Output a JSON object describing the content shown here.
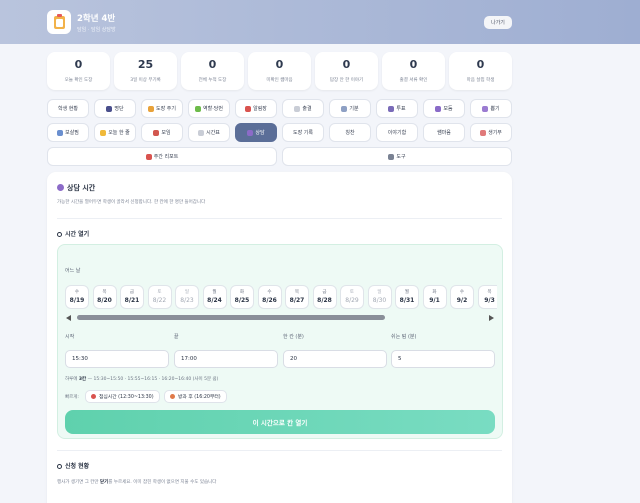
{
  "header": {
    "title": "2학년 4반",
    "subtitle": "담임 · 담임 상담방",
    "exit_label": "나가기"
  },
  "stats": [
    {
      "value": "0",
      "label": "오늘 확인 도장"
    },
    {
      "value": "25",
      "label": "3일 이상 무기록"
    },
    {
      "value": "0",
      "label": "전체 누적 도장"
    },
    {
      "value": "0",
      "label": "미확인 쌤마음"
    },
    {
      "value": "0",
      "label": "답장 안 한 이야기"
    },
    {
      "value": "0",
      "label": "출결 서류 확인"
    },
    {
      "value": "0",
      "label": "마음 살핌 학생"
    }
  ],
  "nav_row1": [
    {
      "label": "학생 현황",
      "icon": "none",
      "color": ""
    },
    {
      "label": "명단",
      "icon": "person-icon",
      "color": "#4a4f8c"
    },
    {
      "label": "도장 주기",
      "icon": "medal-icon",
      "color": "#e8a23a"
    },
    {
      "label": "역할·당번",
      "icon": "puzzle-icon",
      "color": "#6dbb4a"
    },
    {
      "label": "알림장",
      "icon": "notice-icon",
      "color": "#d9534f"
    },
    {
      "label": "출결",
      "icon": "document-icon",
      "color": "#c9cdd6"
    },
    {
      "label": "기분",
      "icon": "cloud-icon",
      "color": "#8ea0c4"
    },
    {
      "label": "투표",
      "icon": "ballot-icon",
      "color": "#7a6bb8"
    },
    {
      "label": "모둠",
      "icon": "group-icon",
      "color": "#8a6bc8"
    },
    {
      "label": "뽑기",
      "icon": "dice-icon",
      "color": "#9b7bd1"
    }
  ],
  "nav_row2": [
    {
      "label": "보살핌",
      "icon": "care-icon",
      "color": "#6a8fcf"
    },
    {
      "label": "오늘 한 줄",
      "icon": "smile-icon",
      "color": "#f0b93a"
    },
    {
      "label": "모임",
      "icon": "tent-icon",
      "color": "#d2574f"
    },
    {
      "label": "시간표",
      "icon": "calendar-icon",
      "color": "#c9cdd6"
    },
    {
      "label": "상담",
      "icon": "chat-icon",
      "color": "#8c6bc8"
    },
    {
      "label": "도장 기록",
      "icon": "none",
      "color": ""
    },
    {
      "label": "칭찬",
      "icon": "none",
      "color": ""
    },
    {
      "label": "이야기함",
      "icon": "none",
      "color": ""
    },
    {
      "label": "쌤마음",
      "icon": "none",
      "color": ""
    },
    {
      "label": "생기부",
      "icon": "book-icon",
      "color": "#e07a7a"
    }
  ],
  "nav_row3": [
    {
      "label": "주간 리포트",
      "icon": "report-icon",
      "color": "#d9534f"
    },
    {
      "label": "도구",
      "icon": "tools-icon",
      "color": "#7a8293"
    }
  ],
  "active_nav": "상담",
  "panel": {
    "title": "상담 시간",
    "desc": "가능한 시간을 열어두면 학생이 골라서 신청합니다. 한 칸에 한 명만 들어갑니다",
    "open_section": "시간 열기",
    "which_day": "어느 날",
    "days": [
      {
        "w": "수",
        "d": "8/19",
        "off": false
      },
      {
        "w": "목",
        "d": "8/20",
        "off": false
      },
      {
        "w": "금",
        "d": "8/21",
        "off": false
      },
      {
        "w": "토",
        "d": "8/22",
        "off": true
      },
      {
        "w": "일",
        "d": "8/23",
        "off": true
      },
      {
        "w": "월",
        "d": "8/24",
        "off": false
      },
      {
        "w": "화",
        "d": "8/25",
        "off": false
      },
      {
        "w": "수",
        "d": "8/26",
        "off": false
      },
      {
        "w": "목",
        "d": "8/27",
        "off": false
      },
      {
        "w": "금",
        "d": "8/28",
        "off": false
      },
      {
        "w": "토",
        "d": "8/29",
        "off": true
      },
      {
        "w": "일",
        "d": "8/30",
        "off": true
      },
      {
        "w": "월",
        "d": "8/31",
        "off": false
      },
      {
        "w": "화",
        "d": "9/1",
        "off": false
      },
      {
        "w": "수",
        "d": "9/2",
        "off": false
      },
      {
        "w": "목",
        "d": "9/3",
        "off": false
      }
    ],
    "fields": [
      {
        "label": "시작",
        "value": "15:30"
      },
      {
        "label": "끝",
        "value": "17:00"
      },
      {
        "label": "한 칸 (분)",
        "value": "20"
      },
      {
        "label": "쉬는 텀 (분)",
        "value": "5"
      }
    ],
    "hint_prefix": "하루에",
    "hint_count": "3칸",
    "hint_rest": "— 15:30~15:50 · 15:55~16:15 · 16:20~16:40 (사이 5분 쉼)",
    "quick_label": "빠르게:",
    "quick": [
      {
        "label": "점심시간 (12:30~13:30)",
        "icon": "bowl-icon",
        "color": "#d9534f"
      },
      {
        "label": "방과 후 (16:20부터)",
        "icon": "school-icon",
        "color": "#e07a4a"
      }
    ],
    "open_button": "이 시간으로 칸 열기",
    "status_section": "신청 현황",
    "status_desc_pre": "행사가 생기면 그 칸만",
    "status_desc_bold": "닫기",
    "status_desc_post": "를 누르세요. 이미 잡힌 학생이 없으면 지울 수도 있습니다"
  }
}
